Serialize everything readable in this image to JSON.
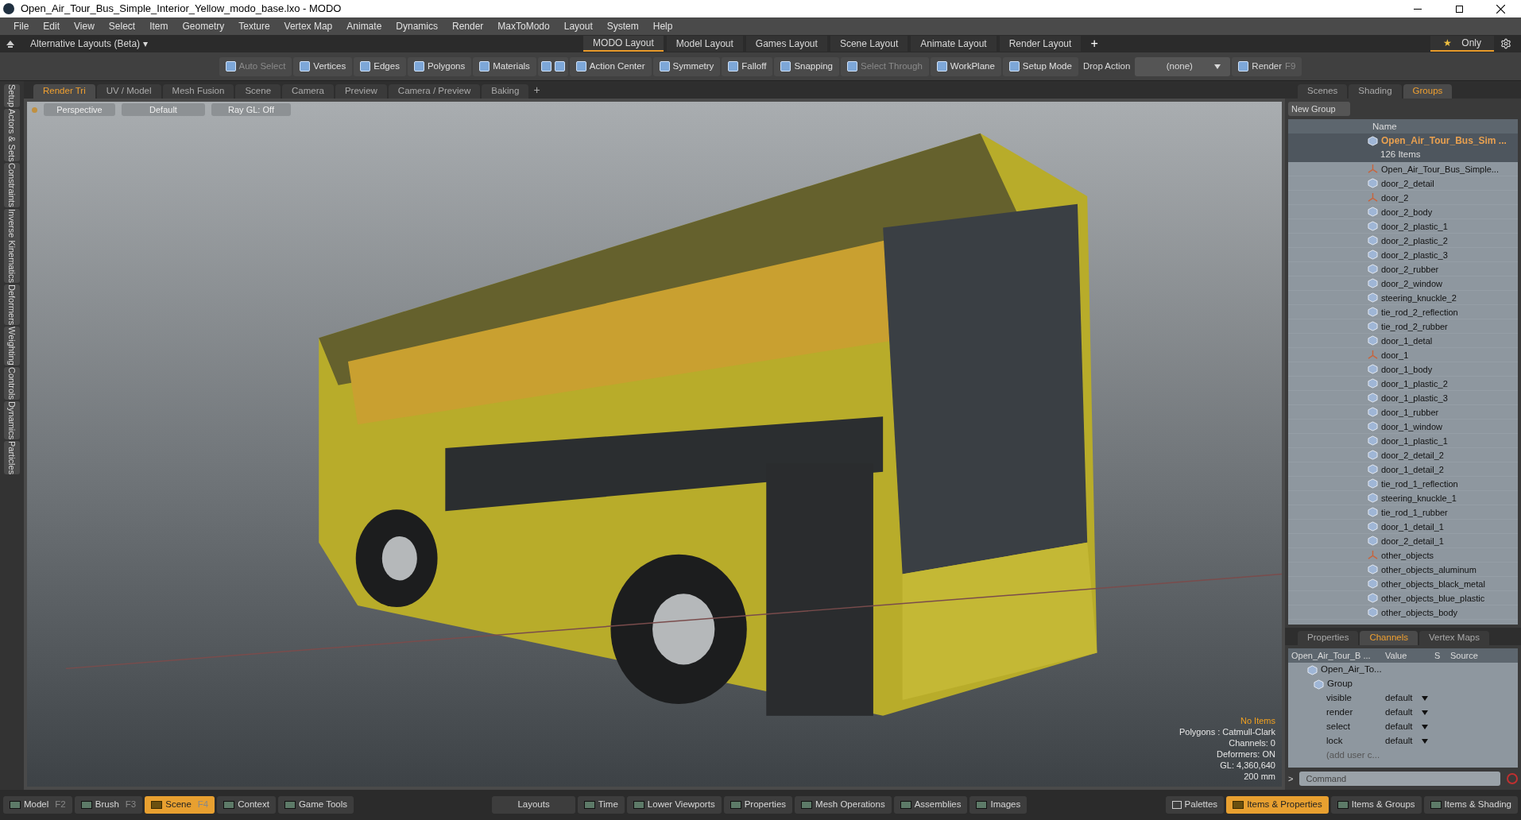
{
  "window": {
    "title": "Open_Air_Tour_Bus_Simple_Interior_Yellow_modo_base.lxo - MODO"
  },
  "menu": [
    "File",
    "Edit",
    "View",
    "Select",
    "Item",
    "Geometry",
    "Texture",
    "Vertex Map",
    "Animate",
    "Dynamics",
    "Render",
    "MaxToModo",
    "Layout",
    "System",
    "Help"
  ],
  "layout_bar": {
    "alt_layouts": "Alternative Layouts (Beta)",
    "caret": "▾",
    "add": "+",
    "only": "Only",
    "star": "★",
    "tabs": [
      {
        "label": "MODO Layout",
        "selected": true
      },
      {
        "label": "Model Layout",
        "selected": false
      },
      {
        "label": "Games Layout",
        "selected": false
      },
      {
        "label": "Scene Layout",
        "selected": false
      },
      {
        "label": "Animate Layout",
        "selected": false
      },
      {
        "label": "Render Layout",
        "selected": false
      }
    ]
  },
  "toolbar": [
    {
      "kind": "tool",
      "label": "Auto Select",
      "disabled": true
    },
    {
      "kind": "tool",
      "label": "Vertices",
      "disabled": false
    },
    {
      "kind": "tool",
      "label": "Edges",
      "disabled": false
    },
    {
      "kind": "tool",
      "label": "Polygons",
      "disabled": false
    },
    {
      "kind": "tool",
      "label": "Materials",
      "disabled": false
    },
    {
      "kind": "iconpair"
    },
    {
      "kind": "tool",
      "label": "Action Center",
      "disabled": false
    },
    {
      "kind": "tool",
      "label": "Symmetry",
      "disabled": false
    },
    {
      "kind": "tool",
      "label": "Falloff",
      "disabled": false
    },
    {
      "kind": "tool",
      "label": "Snapping",
      "disabled": false
    },
    {
      "kind": "tool",
      "label": "Select Through",
      "disabled": true
    },
    {
      "kind": "tool",
      "label": "WorkPlane",
      "disabled": false
    },
    {
      "kind": "tool",
      "label": "Setup Mode",
      "disabled": false
    },
    {
      "kind": "label",
      "label": "Drop Action"
    },
    {
      "kind": "dropdown",
      "label": "(none)"
    },
    {
      "kind": "render",
      "label": "Render",
      "key": "F9"
    }
  ],
  "side_tabs": [
    "Setup",
    "Actors & Sets",
    "Constraints",
    "Inverse Kinematics",
    "Deformers",
    "Weighting",
    "Controls",
    "Dynamics",
    "Particles"
  ],
  "viewport_tabs": [
    {
      "label": "Render Tri",
      "selected": true
    },
    {
      "label": "UV / Model",
      "selected": false
    },
    {
      "label": "Mesh Fusion",
      "selected": false
    },
    {
      "label": "Scene",
      "selected": false
    },
    {
      "label": "Camera",
      "selected": false
    },
    {
      "label": "Preview",
      "selected": false
    },
    {
      "label": "Camera / Preview",
      "selected": false
    },
    {
      "label": "Baking",
      "selected": false
    }
  ],
  "viewport_add": "+",
  "viewport": {
    "view": "Perspective",
    "shading": "Default",
    "raygl": "Ray GL: Off",
    "info": [
      {
        "text": "No Items",
        "highlight": true
      },
      {
        "text": "Polygons : Catmull-Clark",
        "highlight": false
      },
      {
        "text": "Channels: 0",
        "highlight": false
      },
      {
        "text": "Deformers: ON",
        "highlight": false
      },
      {
        "text": "GL: 4,360,640",
        "highlight": false
      },
      {
        "text": "200 mm",
        "highlight": false
      }
    ]
  },
  "groups_panel": {
    "tabs": [
      {
        "label": "Scenes",
        "selected": false
      },
      {
        "label": "Shading",
        "selected": false
      },
      {
        "label": "Groups",
        "selected": true
      }
    ],
    "new_group": "New Group",
    "name_header": "Name",
    "group_name": "Open_Air_Tour_Bus_Sim ...",
    "group_count": "126 Items",
    "items": [
      {
        "name": "Open_Air_Tour_Bus_Simple...",
        "kind": "locator"
      },
      {
        "name": "door_2_detail",
        "kind": "mesh"
      },
      {
        "name": "door_2",
        "kind": "locator"
      },
      {
        "name": "door_2_body",
        "kind": "mesh"
      },
      {
        "name": "door_2_plastic_1",
        "kind": "mesh"
      },
      {
        "name": "door_2_plastic_2",
        "kind": "mesh"
      },
      {
        "name": "door_2_plastic_3",
        "kind": "mesh"
      },
      {
        "name": "door_2_rubber",
        "kind": "mesh"
      },
      {
        "name": "door_2_window",
        "kind": "mesh"
      },
      {
        "name": "steering_knuckle_2",
        "kind": "mesh"
      },
      {
        "name": "tie_rod_2_reflection",
        "kind": "mesh"
      },
      {
        "name": "tie_rod_2_rubber",
        "kind": "mesh"
      },
      {
        "name": "door_1_detal",
        "kind": "mesh"
      },
      {
        "name": "door_1",
        "kind": "locator"
      },
      {
        "name": "door_1_body",
        "kind": "mesh"
      },
      {
        "name": "door_1_plastic_2",
        "kind": "mesh"
      },
      {
        "name": "door_1_plastic_3",
        "kind": "mesh"
      },
      {
        "name": "door_1_rubber",
        "kind": "mesh"
      },
      {
        "name": "door_1_window",
        "kind": "mesh"
      },
      {
        "name": "door_1_plastic_1",
        "kind": "mesh"
      },
      {
        "name": "door_2_detail_2",
        "kind": "mesh"
      },
      {
        "name": "door_1_detail_2",
        "kind": "mesh"
      },
      {
        "name": "tie_rod_1_reflection",
        "kind": "mesh"
      },
      {
        "name": "steering_knuckle_1",
        "kind": "mesh"
      },
      {
        "name": "tie_rod_1_rubber",
        "kind": "mesh"
      },
      {
        "name": "door_1_detail_1",
        "kind": "mesh"
      },
      {
        "name": "door_2_detail_1",
        "kind": "mesh"
      },
      {
        "name": "other_objects",
        "kind": "locator"
      },
      {
        "name": "other_objects_aluminum",
        "kind": "mesh"
      },
      {
        "name": "other_objects_black_metal",
        "kind": "mesh"
      },
      {
        "name": "other_objects_blue_plastic",
        "kind": "mesh"
      },
      {
        "name": "other_objects_body",
        "kind": "mesh"
      }
    ]
  },
  "channels_panel": {
    "tabs": [
      {
        "label": "Properties",
        "selected": false
      },
      {
        "label": "Channels",
        "selected": true
      },
      {
        "label": "Vertex Maps",
        "selected": false
      }
    ],
    "columns": [
      "Open_Air_Tour_B ...",
      "Value",
      "S",
      "Source"
    ],
    "item": "Open_Air_To...",
    "group": "Group",
    "channels": [
      {
        "name": "visible",
        "value": "default"
      },
      {
        "name": "render",
        "value": "default"
      },
      {
        "name": "select",
        "value": "default"
      },
      {
        "name": "lock",
        "value": "default"
      }
    ],
    "add_user": "(add user c...",
    "command_placeholder": "Command",
    "prompt": ">"
  },
  "bottom_bar": {
    "left": [
      {
        "label": "Model",
        "key": "F2",
        "selected": false
      },
      {
        "label": "Brush",
        "key": "F3",
        "selected": false
      },
      {
        "label": "Scene",
        "key": "F4",
        "selected": true
      },
      {
        "label": "Context",
        "selected": false
      },
      {
        "label": "Game Tools",
        "selected": false
      }
    ],
    "center": [
      {
        "label": "Layouts",
        "kind": "plain"
      },
      {
        "label": "Time",
        "kind": "toggle"
      },
      {
        "label": "Lower Viewports",
        "kind": "toggle"
      },
      {
        "label": "Properties",
        "kind": "toggle"
      },
      {
        "label": "Mesh Operations",
        "kind": "toggle"
      },
      {
        "label": "Assemblies",
        "kind": "toggle"
      },
      {
        "label": "Images",
        "kind": "toggle"
      }
    ],
    "right": [
      {
        "label": "Palettes",
        "selected": false,
        "kind": "palette"
      },
      {
        "label": "Items & Properties",
        "selected": true,
        "kind": "toggle"
      },
      {
        "label": "Items & Groups",
        "selected": false,
        "kind": "toggle"
      },
      {
        "label": "Items & Shading",
        "selected": false,
        "kind": "toggle"
      }
    ]
  }
}
